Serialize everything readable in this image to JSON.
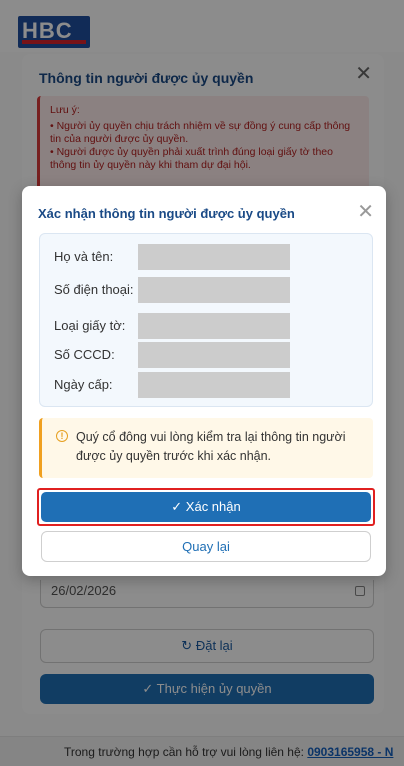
{
  "brand": {
    "logo_text": "HBC"
  },
  "background_modal": {
    "title": "Thông tin người được ủy quyền",
    "note_title": "Lưu ý:",
    "note_lines": [
      "• Người ủy quyền chịu trách nhiệm về sự đồng ý cung cấp thông tin của người được ủy quyền.",
      "• Người được ủy quyền phải xuất trình đúng loại giấy tờ theo thông tin ủy quyền này khi tham dự đại hội."
    ],
    "date_value": "26/02/2026",
    "reset_label": "Đặt lại",
    "execute_label": "Thực hiện ủy quyền"
  },
  "confirm_modal": {
    "title": "Xác nhận thông tin người được ủy quyền",
    "fields": [
      {
        "label": "Họ và tên:"
      },
      {
        "label": "Số điện thoại:"
      },
      {
        "label": "Loại giấy tờ:"
      },
      {
        "label": "Số CCCD:"
      },
      {
        "label": "Ngày cấp:"
      }
    ],
    "warning": "Quý cổ đông vui lòng kiểm tra lại thông tin người được ủy quyền trước khi xác nhận.",
    "confirm_label": "Xác nhận",
    "back_label": "Quay lại"
  },
  "footer": {
    "text": "Trong trường hợp cần hỗ trợ vui lòng liên hệ: ",
    "phone": "0903165958 - N"
  },
  "icons": {
    "close": "close-icon",
    "info": "info-icon",
    "check": "check-icon",
    "reset": "reset-icon",
    "calendar": "calendar-icon"
  },
  "colors": {
    "primary": "#1f6fb5",
    "title": "#1a4a86",
    "highlight": "#e02020",
    "warning": "#f0a020",
    "note": "#d93b3b"
  }
}
